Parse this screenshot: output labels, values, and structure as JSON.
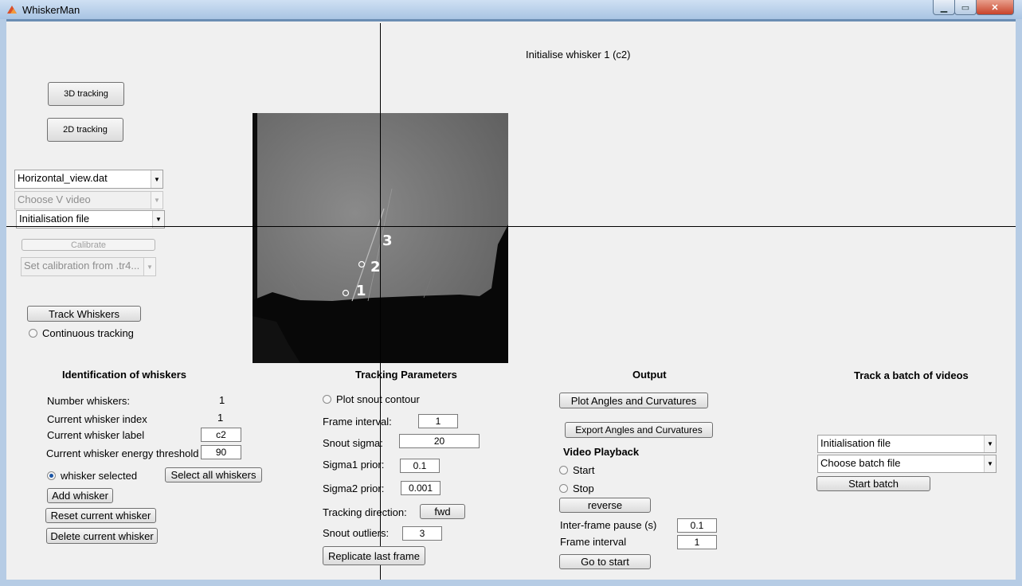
{
  "window": {
    "title": "WhiskerMan",
    "min_icon": "minimize-icon",
    "max_icon": "maximize-icon",
    "close_icon": "close-icon"
  },
  "status": {
    "message": "Initialise whisker 1 (c2)"
  },
  "mode": {
    "btn_3d": "3D tracking",
    "btn_2d": "2D tracking"
  },
  "files": {
    "h_video": "Horizontal_view.dat",
    "v_video": "Choose V video",
    "init_file": "Initialisation file",
    "calibrate": "Calibrate",
    "calibration_select": "Set calibration from .tr4..."
  },
  "tracking_ctrl": {
    "track_button": "Track Whiskers",
    "continuous": "Continuous tracking"
  },
  "video": {
    "markers": [
      "1",
      "2",
      "3"
    ]
  },
  "identification": {
    "heading": "Identification of whiskers",
    "number_label": "Number whiskers:",
    "number_value": "1",
    "index_label": "Current whisker index",
    "index_value": "1",
    "label_label": "Current whisker label",
    "label_value": "c2",
    "energy_label": "Current whisker energy threshold",
    "energy_value": "90",
    "selected_label": "whisker selected",
    "select_all": "Select all whiskers",
    "add": "Add whisker",
    "reset": "Reset current whisker",
    "delete": "Delete current whisker"
  },
  "params": {
    "heading": "Tracking Parameters",
    "plot_snout": "Plot snout contour",
    "frame_interval_label": "Frame interval:",
    "frame_interval_value": "1",
    "snout_sigma_label": "Snout sigma:",
    "snout_sigma_value": "20",
    "sigma1_label": "Sigma1 prior:",
    "sigma1_value": "0.1",
    "sigma2_label": "Sigma2 prior:",
    "sigma2_value": "0.001",
    "direction_label": "Tracking direction:",
    "direction_value": "fwd",
    "outliers_label": "Snout outliers:",
    "outliers_value": "3",
    "replicate": "Replicate last frame"
  },
  "output": {
    "heading": "Output",
    "plot": "Plot Angles and Curvatures",
    "export": "Export Angles and Curvatures",
    "playback_heading": "Video Playback",
    "start": "Start",
    "stop": "Stop",
    "reverse": "reverse",
    "pause_label": "Inter-frame pause (s)",
    "pause_value": "0.1",
    "interval_label": "Frame interval",
    "interval_value": "1",
    "go_to_start": "Go to start"
  },
  "batch": {
    "heading": "Track a batch of videos",
    "init_file": "Initialisation file",
    "batch_file": "Choose batch file",
    "start": "Start batch"
  }
}
